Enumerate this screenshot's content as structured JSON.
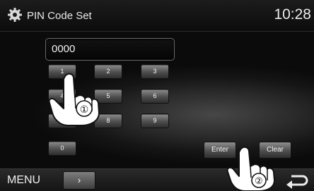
{
  "header": {
    "title": "PIN Code Set",
    "clock": "10:28"
  },
  "pin_field": {
    "value": "0000"
  },
  "keypad": {
    "keys": [
      "1",
      "2",
      "3",
      "4",
      "5",
      "6",
      "7",
      "8",
      "9",
      "0"
    ]
  },
  "actions": {
    "enter_label": "Enter",
    "clear_label": "Clear"
  },
  "bottom_bar": {
    "menu_label": "MENU",
    "next_label": "›"
  },
  "callouts": {
    "step1": "①",
    "step2": "②"
  },
  "icons": {
    "settings": "gear-icon",
    "back": "return-arrow-icon",
    "pointer": "hand-pointer-icon"
  }
}
